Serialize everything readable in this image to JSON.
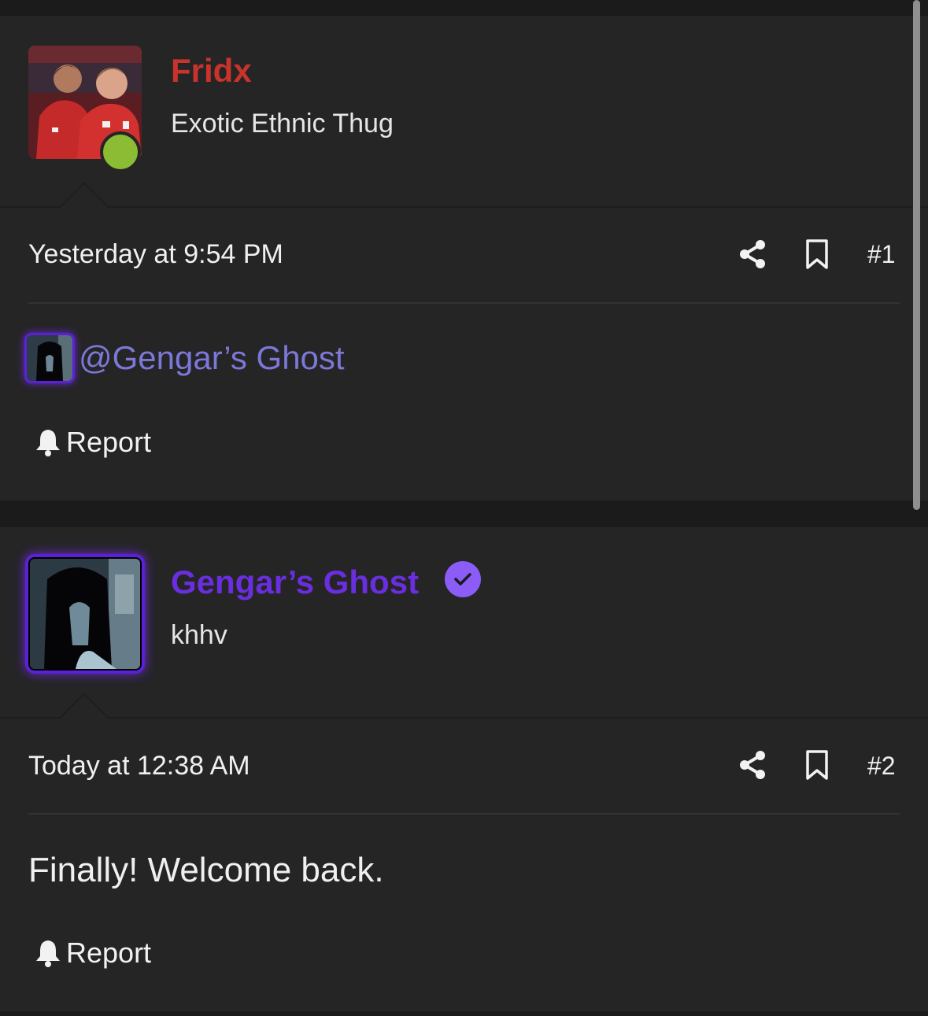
{
  "posts": [
    {
      "username": "Fridx",
      "user_title": "Exotic Ethnic Thug",
      "username_color": "#c8332b",
      "avatar_icon": "football-players-avatar",
      "online": true,
      "timestamp": "Yesterday at 9:54 PM",
      "post_number": "#1",
      "mention": "@Gengar’s Ghost",
      "report_label": "Report"
    },
    {
      "username": "Gengar’s Ghost",
      "user_title": "khhv",
      "username_color": "#6a2ee0",
      "avatar_icon": "ghost-girl-avatar",
      "verified": true,
      "timestamp": "Today at 12:38 AM",
      "post_number": "#2",
      "body": "Finally! Welcome back.",
      "report_label": "Report"
    }
  ],
  "colors": {
    "background": "#1b1b1c",
    "card": "#252526",
    "mention": "#7c78d8",
    "online": "#8bbc33",
    "verified": "#8b5cf6"
  },
  "icons": [
    "share-icon",
    "bookmark-icon",
    "bell-icon",
    "verified-check-icon"
  ]
}
